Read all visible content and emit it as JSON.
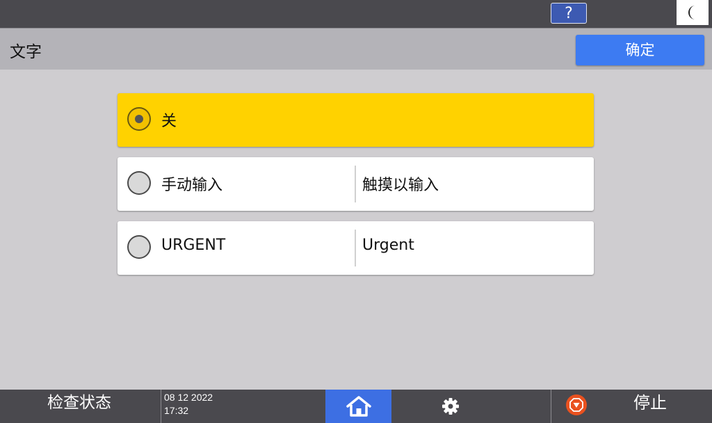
{
  "topbar": {
    "help_label": "?",
    "sleep_icon": "moon-icon"
  },
  "header": {
    "title": "文字",
    "ok_label": "确定"
  },
  "options": [
    {
      "label": "关",
      "value": "",
      "selected": true
    },
    {
      "label": "手动输入",
      "value": "触摸以输入",
      "selected": false
    },
    {
      "label": "URGENT",
      "value": "Urgent",
      "selected": false
    }
  ],
  "bottombar": {
    "status_label": "检查状态",
    "date": "08 12 2022",
    "time": "17:32",
    "home_icon": "home-icon",
    "settings_icon": "gear-icon",
    "stop_icon": "stop-icon",
    "stop_label": "停止"
  },
  "colors": {
    "accent_blue": "#3d7bf2",
    "selected_yellow": "#ffd200",
    "bar_dark": "#4a494e",
    "stop_orange": "#e9511f"
  }
}
